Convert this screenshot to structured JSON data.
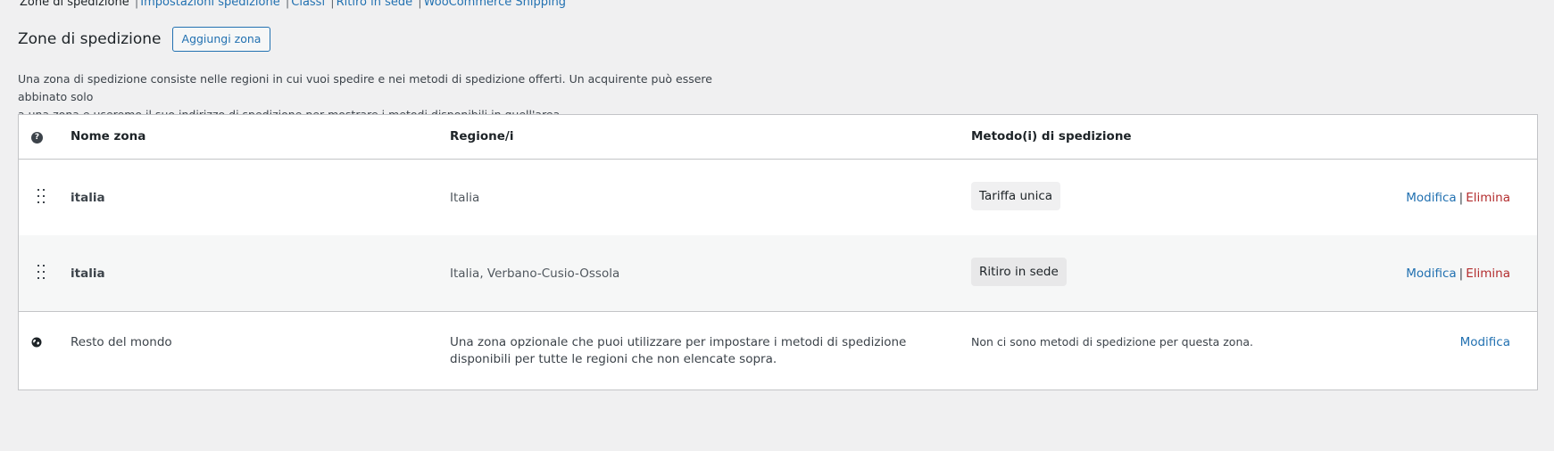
{
  "subnav": {
    "current": "Zone di spedizione",
    "links": [
      "Impostazioni spedizione",
      "Classi",
      "Ritiro in sede",
      "WooCommerce Shipping"
    ]
  },
  "header": {
    "title": "Zone di spedizione",
    "add_button": "Aggiungi zona"
  },
  "description": {
    "line1": "Una zona di spedizione consiste nelle regioni in cui vuoi spedire e nei metodi di spedizione offerti. Un acquirente può essere abbinato solo",
    "line2": "a una zona e useremo il suo indirizzo di spedizione per mostrare i metodi disponibili in quell'area."
  },
  "table": {
    "help_glyph": "?",
    "headers": {
      "name": "Nome zona",
      "regions": "Regione/i",
      "methods": "Metodo(i) di spedizione"
    },
    "rows": [
      {
        "name": "italia",
        "region": "Italia",
        "method": "Tariffa unica",
        "edit": "Modifica",
        "delete": "Elimina"
      },
      {
        "name": "italia",
        "region": "Italia, Verbano-Cusio-Ossola",
        "method": "Ritiro in sede",
        "edit": "Modifica",
        "delete": "Elimina"
      }
    ],
    "rest_of_world": {
      "name": "Resto del mondo",
      "region": "Una zona opzionale che puoi utilizzare per impostare i metodi di spedizione disponibili per tutte le regioni che non elencate sopra.",
      "method": "Non ci sono metodi di spedizione per questa zona.",
      "edit": "Modifica"
    }
  },
  "colors": {
    "link": "#2271b1",
    "delete": "#b32d2e",
    "background": "#f0f0f1"
  }
}
